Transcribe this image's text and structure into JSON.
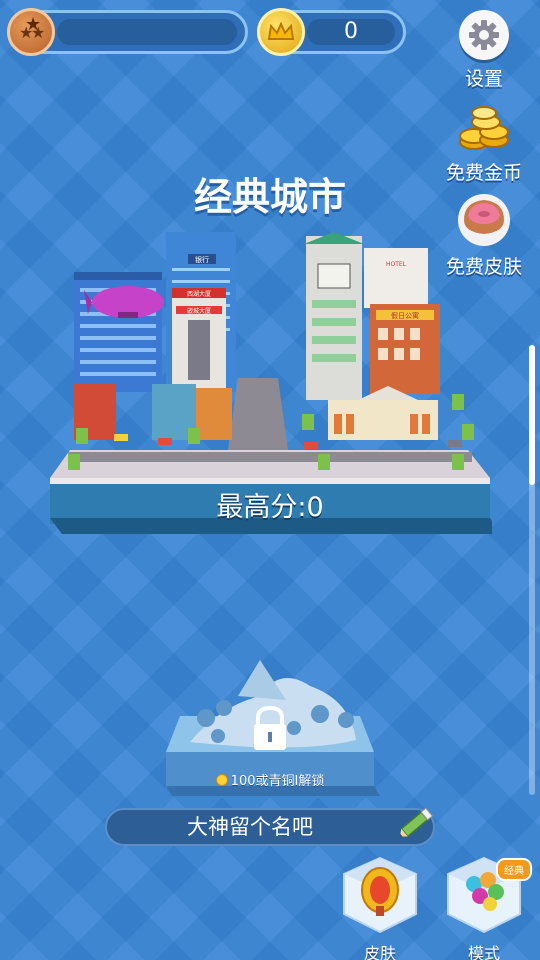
{
  "hud": {
    "rank": {
      "icon": "rank-stars-icon",
      "progress": 0
    },
    "coins": {
      "icon": "crown-coin-icon",
      "value": "0"
    }
  },
  "side_menu": {
    "settings": {
      "label": "设置",
      "icon": "gear-icon"
    },
    "free_coins": {
      "label": "免费金币",
      "icon": "coin-stack-icon"
    },
    "free_skin": {
      "label": "免费皮肤",
      "icon": "donut-icon"
    }
  },
  "map": {
    "title": "经典城市",
    "high_score": "最高分:0",
    "signs": [
      "银行",
      "西湖大厦",
      "嵌城大厦",
      "假日公寓",
      "HOTEL"
    ]
  },
  "locked_map": {
    "unlock_text": "100或青铜I解锁",
    "icon": "lock-icon"
  },
  "name_bar": {
    "text": "大神留个名吧",
    "icon": "pencil-icon"
  },
  "bottom": {
    "skin": {
      "label": "皮肤",
      "icon": "ring-skin-icon"
    },
    "mode": {
      "label": "模式",
      "tag": "经典",
      "icon": "balloon-cube-icon"
    }
  },
  "colors": {
    "background": "#3a86d6",
    "hud_pill": "#2f6fb8",
    "accent_gold": "#ffd23a",
    "platform_blue": "#2e79a8"
  }
}
